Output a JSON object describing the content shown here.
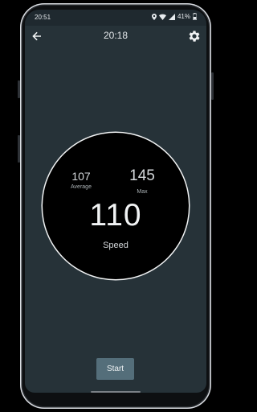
{
  "status_bar": {
    "time": "20:51",
    "battery_percent": "41%",
    "icons": [
      "location-icon",
      "wifi-icon",
      "signal-icon",
      "battery-icon"
    ]
  },
  "app_bar": {
    "title": "20:18",
    "back_icon": "arrow-back-icon",
    "settings_icon": "gear-icon"
  },
  "speedometer": {
    "average_value": "107",
    "average_label": "Average",
    "max_value": "145",
    "max_label": "Max",
    "speed_value": "110",
    "speed_label": "Speed"
  },
  "actions": {
    "start_label": "Start"
  },
  "colors": {
    "screen_background": "#263238",
    "dial_background": "#000000",
    "dial_border": "#f1f3f4",
    "button_background": "#546e7a",
    "text_primary": "#f1f3f4"
  }
}
